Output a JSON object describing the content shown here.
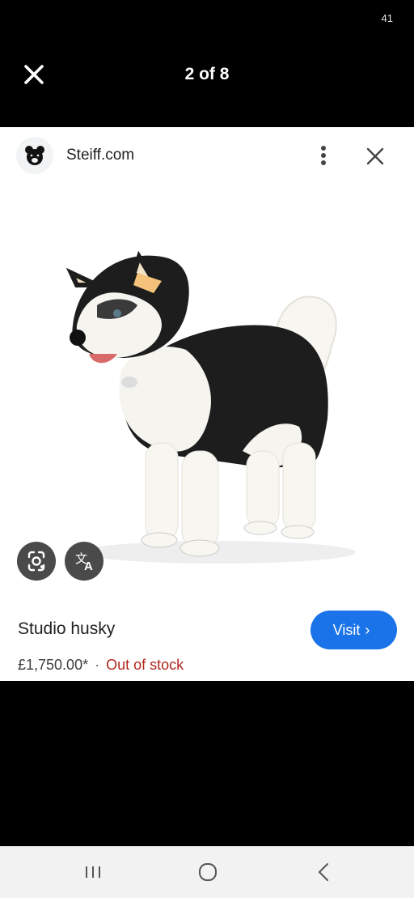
{
  "status": {
    "number": "41"
  },
  "viewer": {
    "counter": "2 of 8"
  },
  "source": {
    "site": "Steiff.com",
    "favicon": "teddy-bear-icon"
  },
  "product": {
    "title": "Studio husky",
    "price": "£1,750.00*",
    "separator": "·",
    "stock": "Out of stock",
    "image": "husky-plush-photo"
  },
  "actions": {
    "visit_label": "Visit",
    "visit_chevron": "›"
  },
  "icons": {
    "close": "close-icon",
    "more": "more-vert-icon",
    "lens": "lens-icon",
    "translate": "translate-icon",
    "recents": "recents-icon",
    "home": "home-icon",
    "back": "back-icon"
  },
  "colors": {
    "accent": "#1a73e8",
    "stock": "#b3261e",
    "background": "#000000",
    "card": "#ffffff"
  }
}
